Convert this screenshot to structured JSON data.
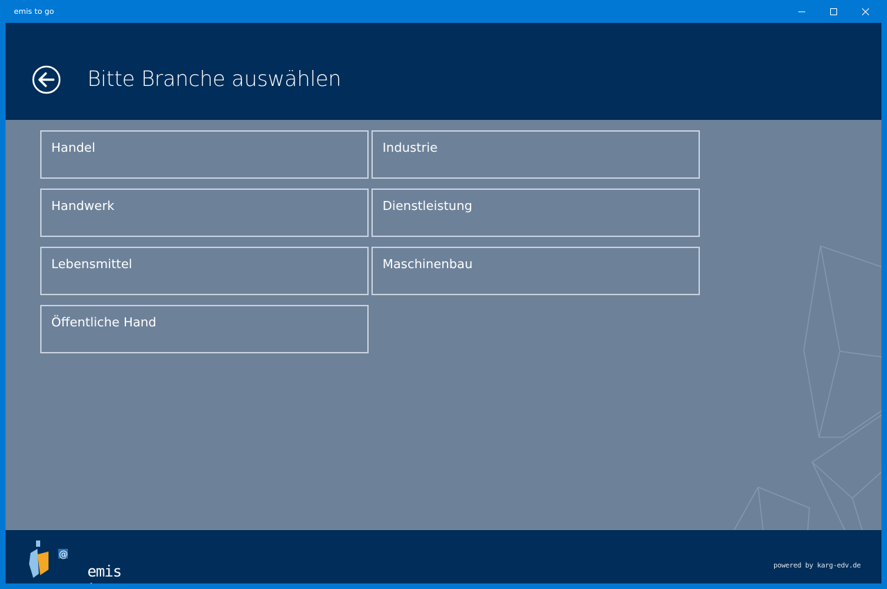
{
  "window": {
    "title": "emis to go"
  },
  "header": {
    "title": "Bitte Branche auswählen",
    "back_icon": "arrow-left-circle-icon"
  },
  "branches": [
    {
      "label": "Handel"
    },
    {
      "label": "Industrie"
    },
    {
      "label": "Handwerk"
    },
    {
      "label": "Dienstleistung"
    },
    {
      "label": "Lebensmittel"
    },
    {
      "label": "Maschinenbau"
    },
    {
      "label": "Öffentliche Hand"
    }
  ],
  "footer": {
    "logo_text": "emis to go",
    "powered_by": "powered by karg-edv.de"
  },
  "colors": {
    "titlebar": "#0078d4",
    "header": "#002d59",
    "content": "#6d8199",
    "tile_border": "#c6d1dd"
  }
}
